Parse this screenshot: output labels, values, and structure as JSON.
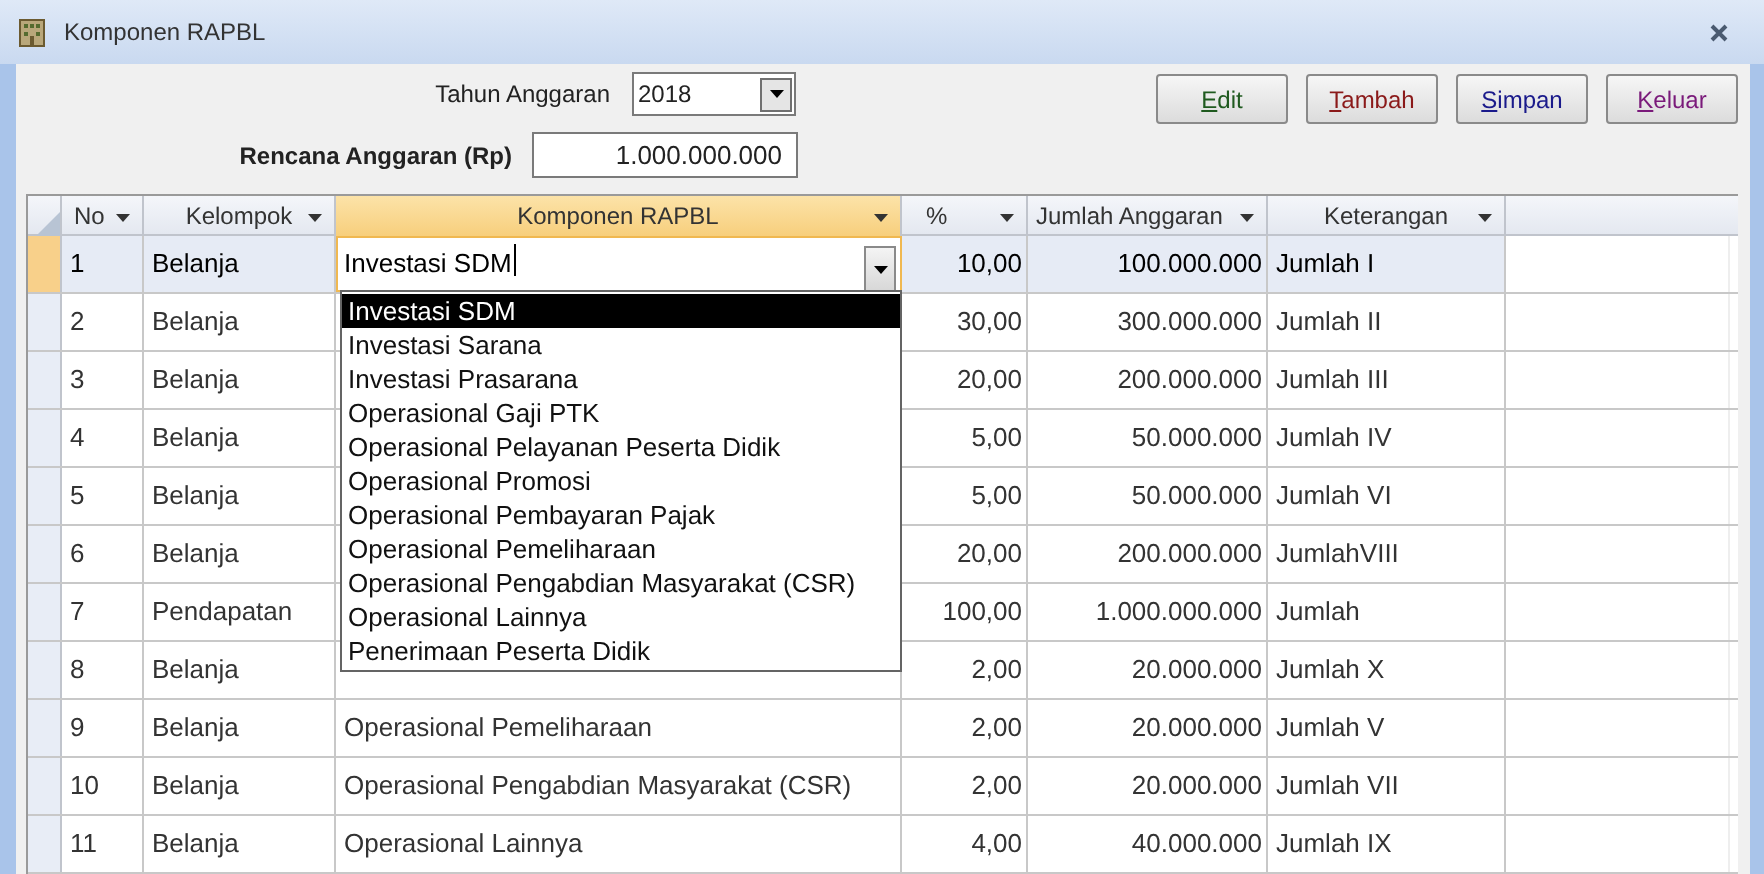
{
  "window": {
    "title": "Komponen RAPBL"
  },
  "year_field": {
    "label": "Tahun Anggaran",
    "value": "2018"
  },
  "budget_field": {
    "label": "Rencana Anggaran (Rp)",
    "value": "1.000.000.000"
  },
  "buttons": [
    {
      "label": "Edit",
      "color": "#1f5a1f"
    },
    {
      "label": "Tambah",
      "color": "#8b1a1a"
    },
    {
      "label": "Simpan",
      "color": "#1a1a8b"
    },
    {
      "label": "Keluar",
      "color": "#7a1a7a"
    }
  ],
  "table": {
    "columns": [
      {
        "label": "No",
        "selected": false
      },
      {
        "label": "Kelompok",
        "selected": false
      },
      {
        "label": "Komponen RAPBL",
        "selected": true
      },
      {
        "label": "%",
        "selected": false
      },
      {
        "label": "Jumlah Anggaran",
        "selected": false
      },
      {
        "label": "Keterangan",
        "selected": false
      }
    ],
    "rows": [
      {
        "no": "1",
        "kelompok": "Belanja",
        "komponen": "Investasi SDM",
        "persen": "10,00",
        "jumlah": "100.000.000",
        "keterangan": "Jumlah I",
        "selected": true
      },
      {
        "no": "2",
        "kelompok": "Belanja",
        "persen": "30,00",
        "jumlah": "300.000.000",
        "keterangan": "Jumlah II",
        "selected": false
      },
      {
        "no": "3",
        "kelompok": "Belanja",
        "persen": "20,00",
        "jumlah": "200.000.000",
        "keterangan": "Jumlah III",
        "selected": false
      },
      {
        "no": "4",
        "kelompok": "Belanja",
        "persen": "5,00",
        "jumlah": "50.000.000",
        "keterangan": "Jumlah IV",
        "selected": false
      },
      {
        "no": "5",
        "kelompok": "Belanja",
        "persen": "5,00",
        "jumlah": "50.000.000",
        "keterangan": "Jumlah VI",
        "selected": false
      },
      {
        "no": "6",
        "kelompok": "Belanja",
        "persen": "20,00",
        "jumlah": "200.000.000",
        "keterangan": "JumlahVIII",
        "selected": false
      },
      {
        "no": "7",
        "kelompok": "Pendapatan",
        "persen": "100,00",
        "jumlah": "1.000.000.000",
        "keterangan": "Jumlah",
        "selected": false
      },
      {
        "no": "8",
        "kelompok": "Belanja",
        "persen": "2,00",
        "jumlah": "20.000.000",
        "keterangan": "Jumlah X",
        "selected": false
      },
      {
        "no": "9",
        "kelompok": "Belanja",
        "komponen": "Operasional Pemeliharaan",
        "persen": "2,00",
        "jumlah": "20.000.000",
        "keterangan": "Jumlah V",
        "selected": false
      },
      {
        "no": "10",
        "kelompok": "Belanja",
        "komponen": "Operasional Pengabdian Masyarakat (CSR)",
        "persen": "2,00",
        "jumlah": "20.000.000",
        "keterangan": "Jumlah VII",
        "selected": false
      },
      {
        "no": "11",
        "kelompok": "Belanja",
        "komponen": "Operasional Lainnya",
        "persen": "4,00",
        "jumlah": "40.000.000",
        "keterangan": "Jumlah IX",
        "selected": false
      }
    ]
  },
  "dropdown": {
    "items": [
      {
        "label": "Investasi SDM",
        "selected": true
      },
      {
        "label": "Investasi Sarana",
        "selected": false
      },
      {
        "label": "Investasi Prasarana",
        "selected": false
      },
      {
        "label": "Operasional Gaji PTK",
        "selected": false
      },
      {
        "label": "Operasional Pelayanan Peserta Didik",
        "selected": false
      },
      {
        "label": "Operasional Promosi",
        "selected": false
      },
      {
        "label": "Operasional Pembayaran Pajak",
        "selected": false
      },
      {
        "label": "Operasional Pemeliharaan",
        "selected": false
      },
      {
        "label": "Operasional Pengabdian Masyarakat (CSR)",
        "selected": false
      },
      {
        "label": "Operasional Lainnya",
        "selected": false
      },
      {
        "label": "Penerimaan Peserta Didik",
        "selected": false
      }
    ]
  }
}
